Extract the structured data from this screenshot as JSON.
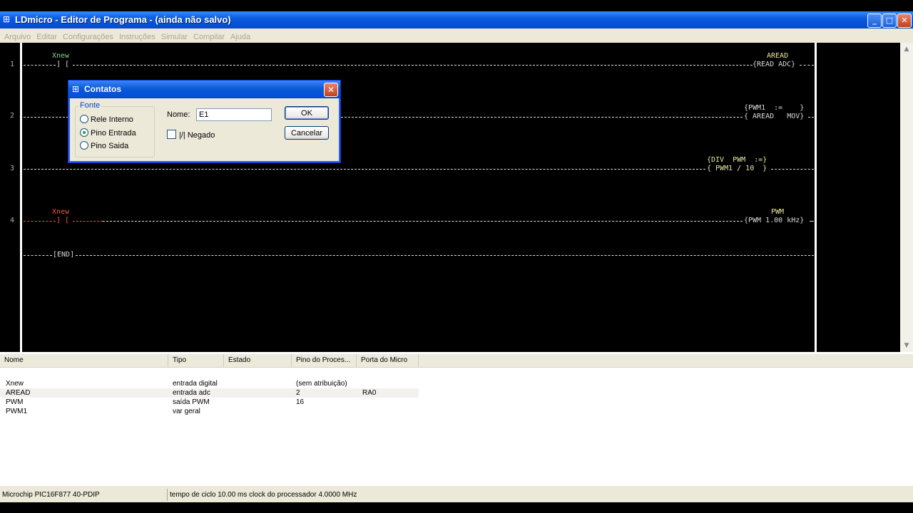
{
  "window": {
    "title": "LDmicro - Editor de Programa - (ainda não salvo)"
  },
  "menu": [
    "Arquivo",
    "Editar",
    "Configurações",
    "Instruções",
    "Simular",
    "Compilar",
    "Ajuda"
  ],
  "ladder": {
    "rungs": [
      {
        "number": "1",
        "contact_name": "Xnew",
        "contact": "] [",
        "coil_name": "AREAD",
        "coil": "{READ ADC}"
      },
      {
        "number": "2",
        "mov_line1": "{PWM1  :=    }",
        "mov_line2": "{ AREAD   MOV}"
      },
      {
        "number": "3",
        "div_line1": "{DIV  PWM  :=}",
        "div_line2": "{ PWM1 / 10  }"
      },
      {
        "number": "4",
        "contact_name": "Xnew",
        "contact": "] [",
        "coil_name": "PWM",
        "coil": "{PWM 1.00 kHz}"
      }
    ],
    "end": "[END]"
  },
  "dialog": {
    "title": "Contatos",
    "group_label": "Fonte",
    "options": [
      "Rele Interno",
      "Pino Entrada",
      "Pino Saida"
    ],
    "selected_index": 1,
    "name_label": "Nome:",
    "name_value": "E1",
    "negate_label": "|/| Negado",
    "ok": "OK",
    "cancel": "Cancelar"
  },
  "io_list": {
    "columns": [
      "Nome",
      "Tipo",
      "Estado",
      "Pino do Proces...",
      "Porta do Micro"
    ],
    "rows": [
      [
        "Xnew",
        "entrada digital",
        "",
        "(sem atribuição)",
        ""
      ],
      [
        "AREAD",
        "entrada adc",
        "",
        "2",
        "RA0"
      ],
      [
        "PWM",
        "saída PWM",
        "",
        "16",
        ""
      ],
      [
        "PWM1",
        "var geral",
        "",
        "",
        ""
      ]
    ]
  },
  "status": {
    "chip": "Microchip PIC16F877 40-PDIP",
    "cycle": "tempo de ciclo 10.00 ms  clock do processador 4.0000 MHz"
  },
  "colors": {
    "title_blue": "#0550d8",
    "contact_green": "#8cd58c",
    "contact_red": "#e85a3a"
  }
}
